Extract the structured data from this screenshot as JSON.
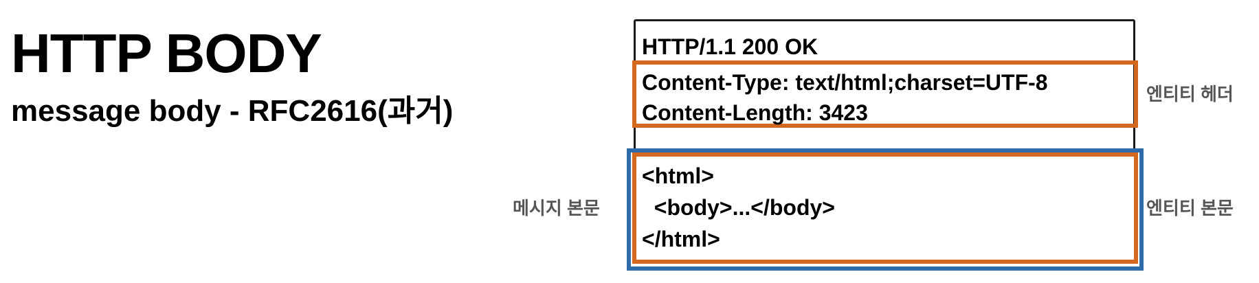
{
  "heading": {
    "title": "HTTP BODY",
    "subtitle": "message body - RFC2616(과거)"
  },
  "message": {
    "status_line": "HTTP/1.1 200 OK",
    "headers": [
      "Content-Type: text/html;charset=UTF-8",
      "Content-Length: 3423"
    ],
    "body_lines": [
      "<html>",
      "  <body>...</body>",
      "</html>"
    ]
  },
  "labels": {
    "entity_header": "엔티티 헤더",
    "entity_body": "엔티티 본문",
    "message_body": "메시지 본문"
  },
  "colors": {
    "entity_outline": "#d2691e",
    "message_body_outline": "#2e6ba8",
    "side_label_text": "#555555"
  }
}
